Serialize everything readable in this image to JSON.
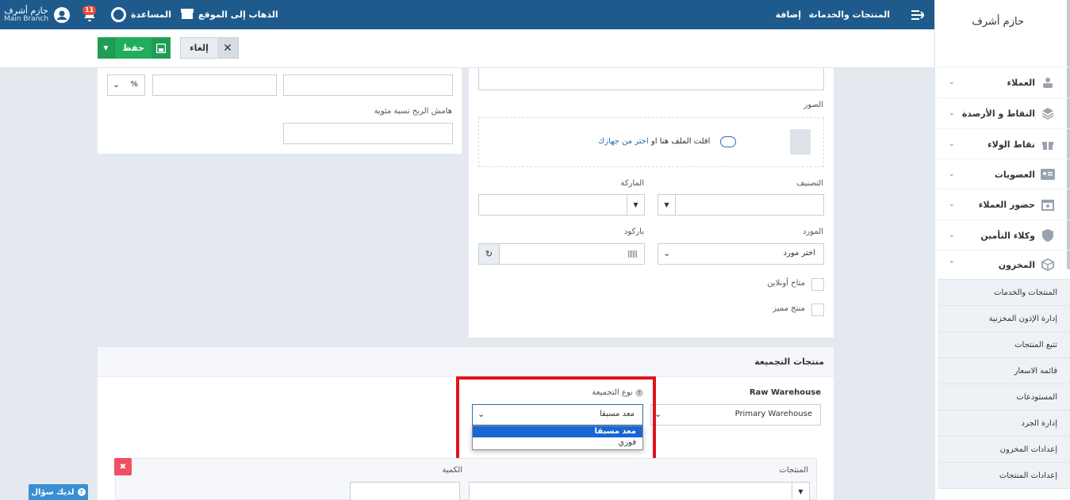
{
  "topbar": {
    "breadcrumb_current": "المنتجات والخدمات",
    "breadcrumb_sep": "›",
    "breadcrumb_action": "إضافة",
    "goto_site": "الذهاب إلى الموقع",
    "help": "المساعدة",
    "notifications_count": "11",
    "user_name": "حازم أشرف",
    "branch": "Main Branch"
  },
  "actions": {
    "save_label": "حفظ",
    "cancel_label": "إلغاء"
  },
  "sidebar": {
    "user_name": "حازم أشرف",
    "items": [
      {
        "label": "العملاء",
        "icon": "users-icon"
      },
      {
        "label": "النقاط و الأرصدة",
        "icon": "layers-icon"
      },
      {
        "label": "نقاط الولاء",
        "icon": "gift-icon"
      },
      {
        "label": "العضويات",
        "icon": "id-card-icon"
      },
      {
        "label": "حضور العملاء",
        "icon": "calendar-icon"
      },
      {
        "label": "وكلاء التأمين",
        "icon": "shield-icon"
      },
      {
        "label": "المخزون",
        "icon": "box-icon"
      }
    ],
    "sub_items": [
      "المنتجات والخدمات",
      "إدارة الإذون المخزنية",
      "تتبع المنتجات",
      "قائمه الاسعار",
      "المستودعات",
      "إدارة الجرد",
      "إعدادات المخزون",
      "إعدادات المنتجات"
    ]
  },
  "form": {
    "profit_margin_label": "هامش الربح نسبة مئوية",
    "percent_option": "%",
    "images_label": "الصور",
    "upload_text": "افلت الملف هنا او",
    "upload_link": "اختر من جهازك",
    "category_label": "التصنيف",
    "brand_label": "الماركة",
    "supplier_label": "المورد",
    "supplier_value": "اختر مورد",
    "barcode_label": "باركود",
    "available_online": "متاح أونلاين",
    "featured_product": "منتج مميز"
  },
  "group": {
    "title": "منتجات التجميعة",
    "raw_warehouse_label": "Raw Warehouse",
    "raw_warehouse_value": "Primary Warehouse",
    "bundle_type_label": "نوع التجميعة",
    "bundle_type_value": "معد مسبقا",
    "bundle_type_options": [
      "معد مسبقا",
      "فوري"
    ],
    "products_label": "المنتجات",
    "quantity_label": "الكمية"
  },
  "help_button": "لديك سؤال"
}
